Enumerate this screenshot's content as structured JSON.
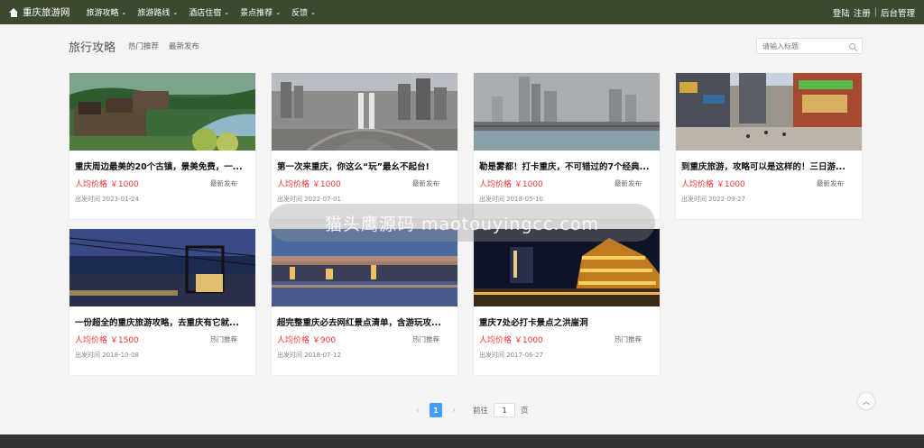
{
  "nav": {
    "brand": "重庆旅游网",
    "menu": [
      "旅游攻略",
      "旅游路线",
      "酒店住宿",
      "景点推荐",
      "反馈"
    ],
    "login": "登陆",
    "register": "注册",
    "admin": "后台管理",
    "sep": "|"
  },
  "header": {
    "title": "旅行攻略",
    "tabs": [
      "热门推荐",
      "最新发布"
    ],
    "search_placeholder": "请输入标题"
  },
  "cards": [
    {
      "title": "重庆周边最美的20个古镇，景美免费，一...",
      "price": "人均价格 ￥1000",
      "tag": "最新发布",
      "date": "出发时间 2023-01-24"
    },
    {
      "title": "第一次来重庆，你这么“玩”最幺不起台!",
      "price": "人均价格 ￥1000",
      "tag": "最新发布",
      "date": "出发时间 2022-07-01"
    },
    {
      "title": "勒是雾都！打卡重庆，不可错过的7个经典...",
      "price": "人均价格 ￥1000",
      "tag": "最新发布",
      "date": "出发时间 2018-05-10"
    },
    {
      "title": "到重庆旅游，攻略可以是这样的！三日游...",
      "price": "人均价格 ￥1000",
      "tag": "最新发布",
      "date": "出发时间 2022-09-27"
    },
    {
      "title": "一份超全的重庆旅游攻略，去重庆有它就...",
      "price": "人均价格 ￥1500",
      "tag": "热门推荐",
      "date": "出发时间 2018-10-08"
    },
    {
      "title": "超完整重庆必去网红景点清单，含游玩攻...",
      "price": "人均价格 ￥900",
      "tag": "热门推荐",
      "date": "出发时间 2018-07-12"
    },
    {
      "title": "重庆7处必打卡景点之洪崖洞",
      "price": "人均价格 ￥1000",
      "tag": "热门推荐",
      "date": "出发时间 2017-06-27"
    }
  ],
  "pager": {
    "prev": "‹",
    "current": "1",
    "next": "›",
    "goto_label": "前往",
    "goto_value": "1",
    "page_unit": "页"
  },
  "back_top": "︿",
  "overlay_text": "猫头鹰源码 maotouyingcc.com"
}
